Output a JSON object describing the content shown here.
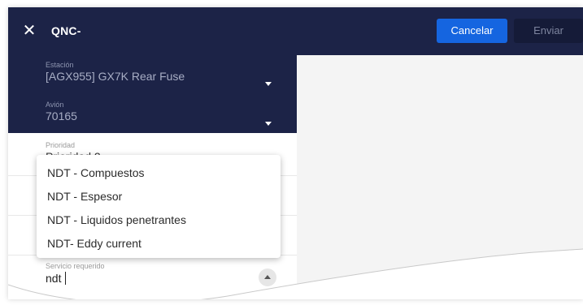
{
  "header": {
    "close_icon": "close-icon",
    "title": "QNC-",
    "cancel_label": "Cancelar",
    "send_label": "Enviar"
  },
  "form": {
    "station": {
      "label": "Estación",
      "value": "[AGX955] GX7K Rear Fuse"
    },
    "aircraft": {
      "label": "Avión",
      "value": "70165"
    },
    "priority": {
      "label": "Prioridad",
      "value": "Prioridad 2"
    },
    "service": {
      "label": "Servicio requerido",
      "value": "ndt"
    }
  },
  "dropdown": {
    "options": [
      "NDT - Compuestos",
      "NDT - Espesor",
      "NDT - Liquidos penetrantes",
      "NDT- Eddy current"
    ]
  },
  "colors": {
    "header_bg": "#1c2347",
    "primary_button": "#1565e0",
    "secondary_button": "#151b38",
    "content_bg": "#f4f4f4"
  }
}
